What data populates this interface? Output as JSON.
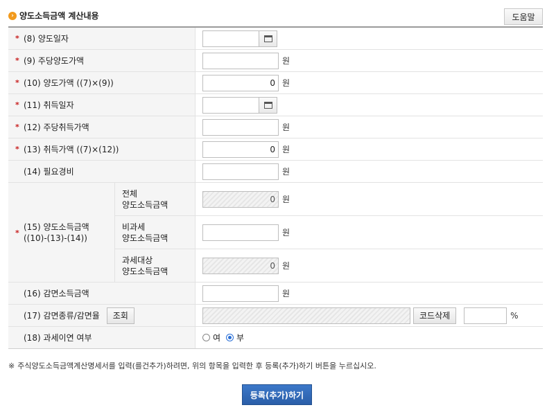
{
  "section": {
    "title": "양도소득금액 계산내용",
    "help_button": "도움말"
  },
  "rows": {
    "r8": {
      "star": "*",
      "label": "(8) 양도일자",
      "value": ""
    },
    "r9": {
      "star": "*",
      "label": "(9) 주당양도가액",
      "value": "",
      "unit": "원"
    },
    "r10": {
      "star": "*",
      "label": "(10) 양도가액 ((7)×(9))",
      "value": "0",
      "unit": "원"
    },
    "r11": {
      "star": "*",
      "label": "(11) 취득일자",
      "value": ""
    },
    "r12": {
      "star": "*",
      "label": "(12) 주당취득가액",
      "value": "",
      "unit": "원"
    },
    "r13": {
      "star": "*",
      "label": "(13) 취득가액 ((7)×(12))",
      "value": "0",
      "unit": "원"
    },
    "r14": {
      "label": "(14) 필요경비",
      "value": "",
      "unit": "원"
    },
    "r15": {
      "star": "*",
      "label_line1": "(15) 양도소득금액",
      "label_line2": "((10)-(13)-(14))",
      "subs": [
        {
          "line1": "전체",
          "line2": "양도소득금액",
          "value": "0",
          "unit": "원"
        },
        {
          "line1": "비과세",
          "line2": "양도소득금액",
          "value": "",
          "unit": "원"
        },
        {
          "line1": "과세대상",
          "line2": "양도소득금액",
          "value": "0",
          "unit": "원"
        }
      ]
    },
    "r16": {
      "label": "(16) 감면소득금액",
      "value": "",
      "unit": "원"
    },
    "r17": {
      "label": "(17) 감면종류/감면율",
      "lookup_button": "조회",
      "delete_button": "코드삭제",
      "percent_unit": "%"
    },
    "r18": {
      "label": "(18) 과세이연 여부",
      "option_yes": "여",
      "option_no": "부",
      "selected": "부"
    }
  },
  "note": {
    "mark": "※",
    "text": "주식양도소득금액계산명세서를 입력(를건추가)하려면, 위의 항목을 입력한 후 등록(추가)하기 버튼을 누르십시오."
  },
  "submit_button": "등록(추가)하기",
  "colors": {
    "accent": "#2a5ea8",
    "required_star": "#c82020",
    "title_icon": "#f29a1d"
  }
}
